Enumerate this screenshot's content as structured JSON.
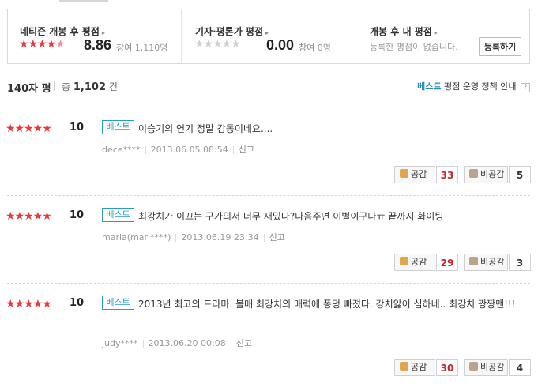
{
  "summary": {
    "netizen": {
      "title": "네티즌 개봉 후 평점",
      "score": "8.86",
      "participants_label": "참여",
      "participants": "1,110명",
      "stars": "★★★★",
      "star_half": "★",
      "stars_off": ""
    },
    "critic": {
      "title": "기자·평론가 평점",
      "score": "0.00",
      "participants_label": "참여",
      "participants": "0명",
      "stars": "",
      "stars_off": "★★★★★"
    },
    "mine": {
      "title": "개봉 후 내 평점",
      "desc": "등록한 평점이 없습니다.",
      "register_label": "등록하기"
    },
    "arrow_icon": "▸"
  },
  "list_header": {
    "title": "140자 평",
    "total_label": "총",
    "total": "1,102",
    "total_unit": "건",
    "best_label": "베스트",
    "policy_label": "평점 운영 정책 안내",
    "help_label": "?"
  },
  "reviews": [
    {
      "stars": "★★★★★",
      "score": "10",
      "badge": "베스트",
      "text": "이승기의 연기 정말 감동이네요....",
      "user": "dece****",
      "date": "2013.06.05 08:54",
      "report": "신고",
      "like_label": "공감",
      "likes": "33",
      "dislike_label": "비공감",
      "dislikes": "5"
    },
    {
      "stars": "★★★★★",
      "score": "10",
      "badge": "베스트",
      "text": "최강치가 이끄는 구가의서 너무 재밌다?다음주면 이별이구나ㅠ 끝까지 화이팅",
      "user": "maria(mari****)",
      "date": "2013.06.19 23:34",
      "report": "신고",
      "like_label": "공감",
      "likes": "29",
      "dislike_label": "비공감",
      "dislikes": "3"
    },
    {
      "stars": "★★★★★",
      "score": "10",
      "badge": "베스트",
      "text": "2013년 최고의 드라마. 볼매 최강치의 매력에 퐁덩 빠졌다. 강치앓이 심하네.. 최강치 짱짱맨!!!",
      "user": "judy****",
      "date": "2013.06.20 00:08",
      "report": "신고",
      "like_label": "공감",
      "likes": "30",
      "dislike_label": "비공감",
      "dislikes": "4"
    }
  ],
  "colors": {
    "star": "#e8383d",
    "best": "#2b9ac4",
    "like_count": "#c1272d"
  }
}
